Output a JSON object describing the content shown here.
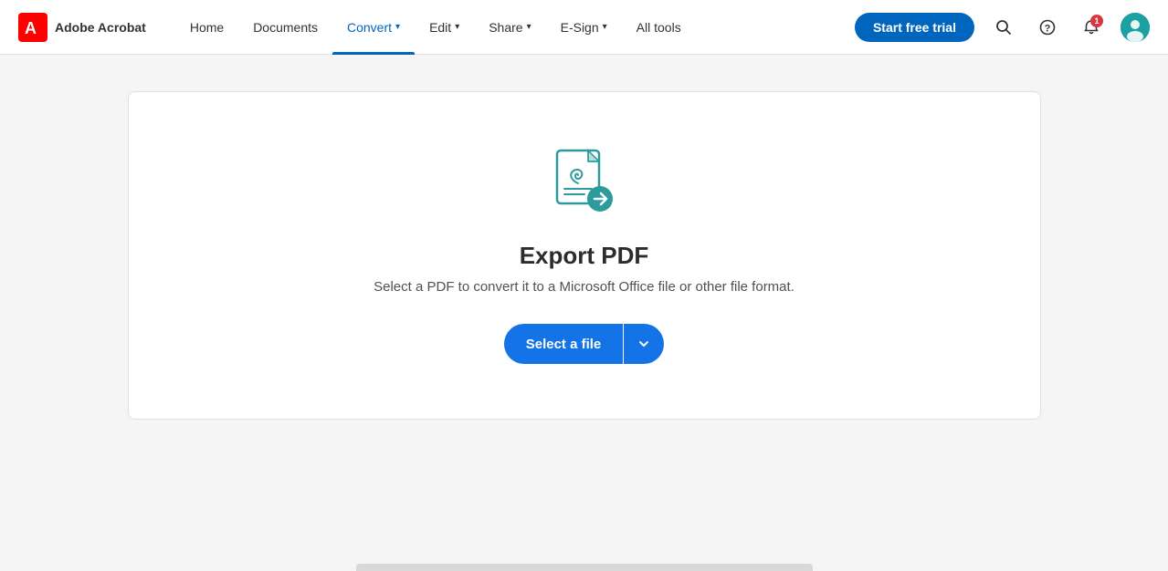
{
  "brand": {
    "app_name": "Adobe Acrobat"
  },
  "nav": {
    "links": [
      {
        "id": "home",
        "label": "Home",
        "active": false,
        "has_dropdown": false
      },
      {
        "id": "documents",
        "label": "Documents",
        "active": false,
        "has_dropdown": false
      },
      {
        "id": "convert",
        "label": "Convert",
        "active": true,
        "has_dropdown": true
      },
      {
        "id": "edit",
        "label": "Edit",
        "active": false,
        "has_dropdown": true
      },
      {
        "id": "share",
        "label": "Share",
        "active": false,
        "has_dropdown": true
      },
      {
        "id": "esign",
        "label": "E-Sign",
        "active": false,
        "has_dropdown": true
      },
      {
        "id": "all-tools",
        "label": "All tools",
        "active": false,
        "has_dropdown": false
      }
    ],
    "cta_label": "Start free trial",
    "notification_count": "1"
  },
  "export_card": {
    "title": "Export PDF",
    "description": "Select a PDF to convert it to a Microsoft Office file or other file format.",
    "select_button_label": "Select a file"
  }
}
